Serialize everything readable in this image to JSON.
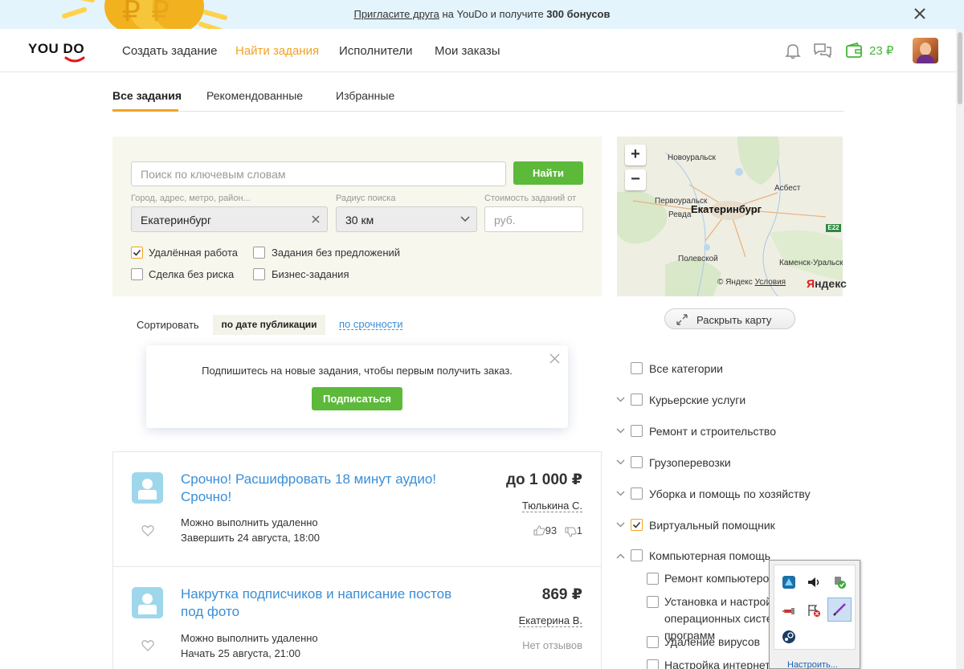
{
  "promo": {
    "invite_link": "Пригласите друга",
    "text_middle": " на YouDo и получите ",
    "bonus": "300 бонусов"
  },
  "header": {
    "logo": "YOU DO",
    "nav": [
      "Создать задание",
      "Найти задания",
      "Исполнители",
      "Мои заказы"
    ],
    "active_nav": "Найти задания",
    "wallet": "23 ₽"
  },
  "tabs": [
    "Все задания",
    "Рекомендованные",
    "Избранные"
  ],
  "filter": {
    "search_placeholder": "Поиск по ключевым словам",
    "search_button": "Найти",
    "city_label": "Город, адрес, метро, район...",
    "city_value": "Екатеринбург",
    "radius_label": "Радиус поиска",
    "radius_value": "30 км",
    "cost_label": "Стоимость заданий от",
    "cost_placeholder": "руб.",
    "checkboxes": [
      {
        "label": "Удалённая работа",
        "checked": true
      },
      {
        "label": "Задания без предложений",
        "checked": false
      },
      {
        "label": "Сделка без риска",
        "checked": false
      },
      {
        "label": "Бизнес-задания",
        "checked": false
      }
    ]
  },
  "map": {
    "zoom_in": "+",
    "zoom_out": "−",
    "labels": [
      "Новоуральск",
      "Асбест",
      "Первоуральск",
      "Ревда",
      "Екатеринбург",
      "Полевской",
      "Каменск-Уральский"
    ],
    "road": "E22",
    "copyright": "© Яндекс",
    "terms": "Условия",
    "brand_first": "Я",
    "brand_rest": "ндекс",
    "open_button": "Раскрыть карту"
  },
  "sort": {
    "label": "Сортировать",
    "active": "по дате публикации",
    "other": "по срочности"
  },
  "subscribe": {
    "text": "Подпишитесь на новые задания, чтобы первым получить заказ.",
    "button": "Подписаться"
  },
  "tasks": [
    {
      "title": "Срочно! Расшифровать 18 минут аудио! Срочно!",
      "remote": "Можно выполнить удаленно",
      "deadline": "Завершить 24 августа, 18:00",
      "price": "до 1 000 ₽",
      "author": "Тюлькина С.",
      "likes": "93",
      "dislikes": "1"
    },
    {
      "title": "Накрутка подписчиков и написание постов под фото",
      "remote": "Можно выполнить удаленно",
      "deadline": "Начать 25 августа, 21:00",
      "price": "869 ₽",
      "author": "Екатерина В.",
      "no_reviews": "Нет отзывов"
    }
  ],
  "categories": [
    {
      "label": "Все категории",
      "checked": false
    },
    {
      "label": "Курьерские услуги",
      "checked": false
    },
    {
      "label": "Ремонт и строительство",
      "checked": false
    },
    {
      "label": "Грузоперевозки",
      "checked": false
    },
    {
      "label": "Уборка и помощь по хозяйству",
      "checked": false
    },
    {
      "label": "Виртуальный помощник",
      "checked": true
    },
    {
      "label": "Компьютерная помощь",
      "checked": false
    }
  ],
  "subcategories": [
    "Ремонт компьютеров",
    "Установка и настройка операционных систем, программ",
    "Удаление вирусов",
    "Настройка интернета"
  ],
  "tray": {
    "customize": "Настроить..."
  }
}
